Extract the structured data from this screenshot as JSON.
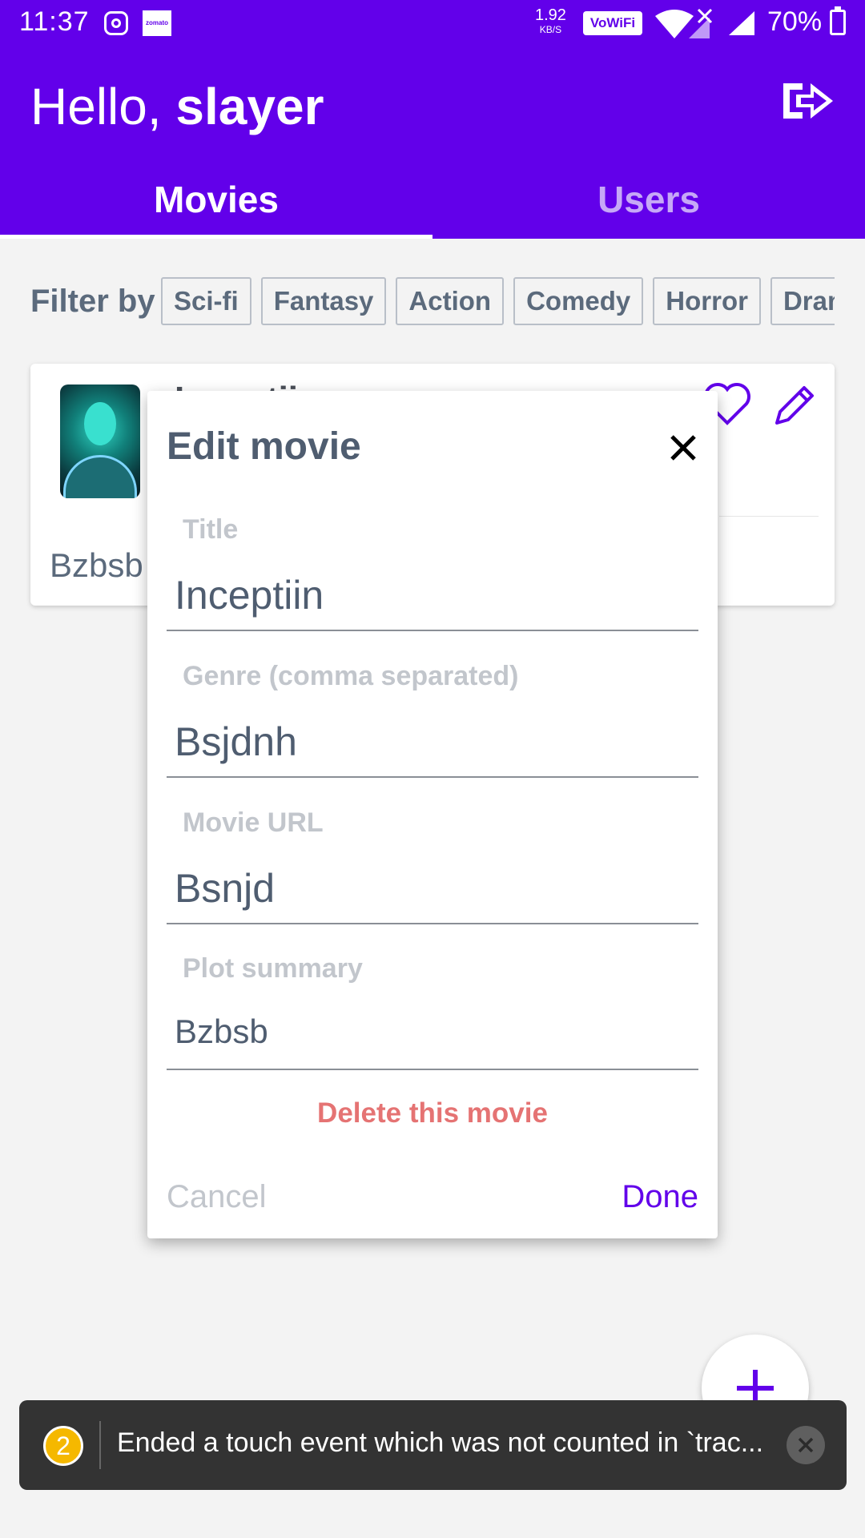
{
  "status_bar": {
    "time": "11:37",
    "net_speed": "1.92",
    "net_speed_unit": "KB/S",
    "vowifi": "VoWiFi",
    "battery": "70%",
    "zomato": "zomato"
  },
  "header": {
    "greeting": "Hello, ",
    "username": "slayer",
    "tabs": [
      {
        "label": "Movies",
        "active": true
      },
      {
        "label": "Users",
        "active": false
      }
    ]
  },
  "filter": {
    "label": "Filter by",
    "chips": [
      "Sci-fi",
      "Fantasy",
      "Action",
      "Comedy",
      "Horror",
      "Drama"
    ]
  },
  "movie_card": {
    "title": "Inceptiin",
    "plot": "Bzbsb"
  },
  "modal": {
    "title": "Edit movie",
    "fields": [
      {
        "label": "Title",
        "value": "Inceptiin"
      },
      {
        "label": "Genre (comma separated)",
        "value": "Bsjdnh"
      },
      {
        "label": "Movie URL",
        "value": "Bsnjd"
      },
      {
        "label": "Plot summary",
        "value": "Bzbsb"
      }
    ],
    "delete_label": "Delete this movie",
    "cancel_label": "Cancel",
    "done_label": "Done"
  },
  "toast": {
    "count": "2",
    "message": "Ended a touch event which was not counted in `trac..."
  },
  "colors": {
    "primary": "#6200ea",
    "danger": "#e57373",
    "text": "#4f5d70",
    "muted": "#c2c6cc"
  },
  "icons": {
    "logout": "logout-icon",
    "favorite": "heart-icon",
    "edit": "pencil-icon",
    "close": "close-icon",
    "add": "plus-icon"
  }
}
